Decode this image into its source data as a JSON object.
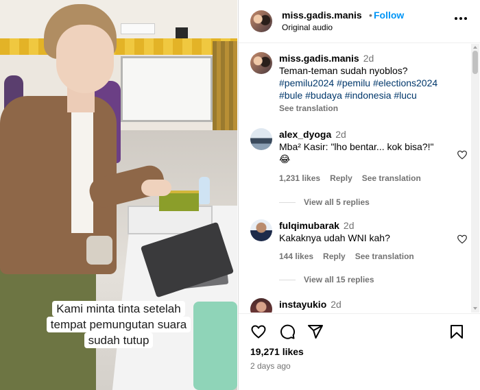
{
  "video": {
    "caption_lines": [
      "Kami minta tinta setelah",
      "tempat pemungutan suara",
      "sudah tutup"
    ]
  },
  "header": {
    "username": "miss.gadis.manis",
    "separator": "•",
    "follow_label": "Follow",
    "audio": "Original audio"
  },
  "post": {
    "username": "miss.gadis.manis",
    "time": "2d",
    "text": "Teman-teman sudah nyoblos?",
    "hashtags_line1": "#pemilu2024 #pemilu #elections2024",
    "hashtags_line2": "#bule #budaya #indonesia #lucu",
    "see_translation": "See translation"
  },
  "comments": [
    {
      "username": "alex_dyoga",
      "time": "2d",
      "text": "Mba² Kasir: \"lho bentar... kok bisa?!\"",
      "emoji": "😂",
      "likes": "1,231 likes",
      "reply": "Reply",
      "see_translation": "See translation",
      "view_replies": "View all 5 replies"
    },
    {
      "username": "fulqimubarak",
      "time": "2d",
      "text": "Kakaknya udah WNI kah?",
      "likes": "144 likes",
      "reply": "Reply",
      "see_translation": "See translation",
      "view_replies": "View all 15 replies"
    },
    {
      "username": "instayukio",
      "time": "2d"
    }
  ],
  "footer": {
    "likes": "19,271 likes",
    "posted": "2 days ago"
  },
  "icons": [
    "heart-icon",
    "comment-icon",
    "share-icon",
    "bookmark-icon",
    "more-icon"
  ]
}
